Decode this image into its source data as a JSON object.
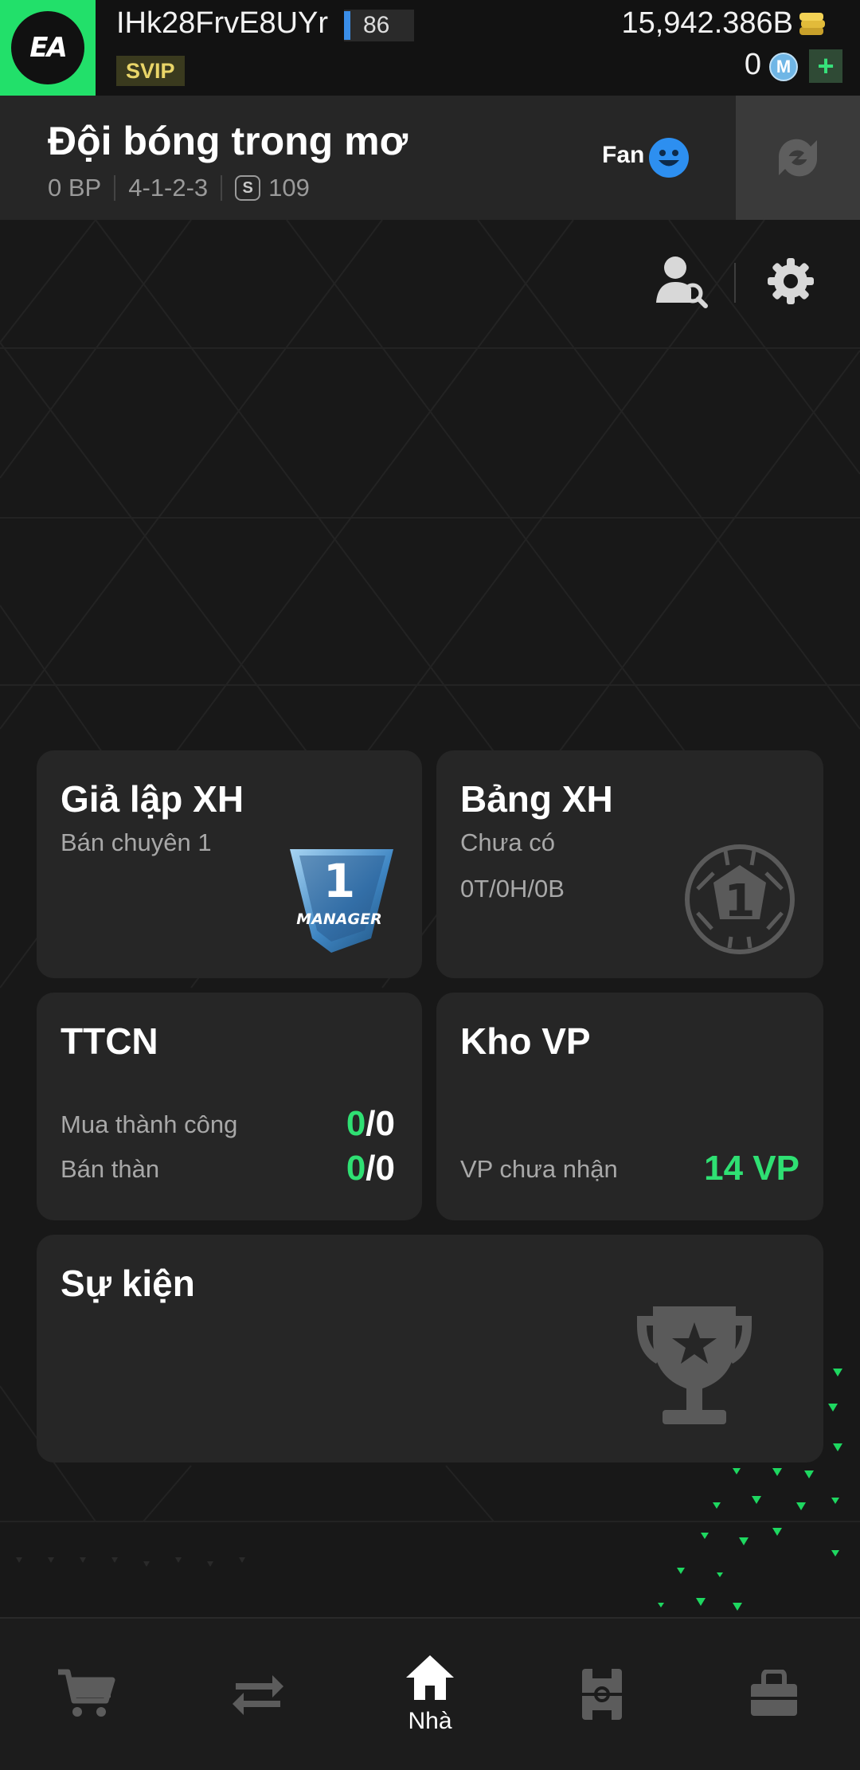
{
  "header": {
    "brand": "EA",
    "username": "IHk28FrvE8UYr",
    "level": "86",
    "vip": "SVIP",
    "coins": "15,942.386B",
    "mcoins": "0",
    "add_label": "+"
  },
  "team": {
    "name": "Đội bóng trong mơ",
    "bp": "0 BP",
    "formation": "4-1-2-3",
    "season_badge": "S",
    "season_value": "109",
    "fan_label": "Fan"
  },
  "cards": {
    "sim": {
      "title": "Giả lập XH",
      "sub": "Bán chuyên 1",
      "badge_text": "MANAGER"
    },
    "rank": {
      "title": "Bảng XH",
      "status": "Chưa có",
      "record": "0T/0H/0B"
    },
    "ttcn": {
      "title": "TTCN",
      "buy_label": "Mua thành công",
      "buy_success": "0",
      "buy_total": "/0",
      "sell_label": "Bán thàn",
      "sell_success": "0",
      "sell_total": "/0"
    },
    "khovp": {
      "title": "Kho VP",
      "vp_label": "VP chưa nhận",
      "vp_value": "14 VP"
    },
    "event": {
      "title": "Sự kiện"
    }
  },
  "nav": {
    "items": [
      {
        "icon": "cart-icon",
        "label": ""
      },
      {
        "icon": "transfer-icon",
        "label": ""
      },
      {
        "icon": "home-icon",
        "label": "Nhà"
      },
      {
        "icon": "pitch-icon",
        "label": ""
      },
      {
        "icon": "bag-icon",
        "label": ""
      }
    ]
  },
  "colors": {
    "accent_green": "#2fe073",
    "ea_green": "#22e06a",
    "level_blue": "#3a8ee8",
    "fan_blue": "#2d8ff0"
  }
}
